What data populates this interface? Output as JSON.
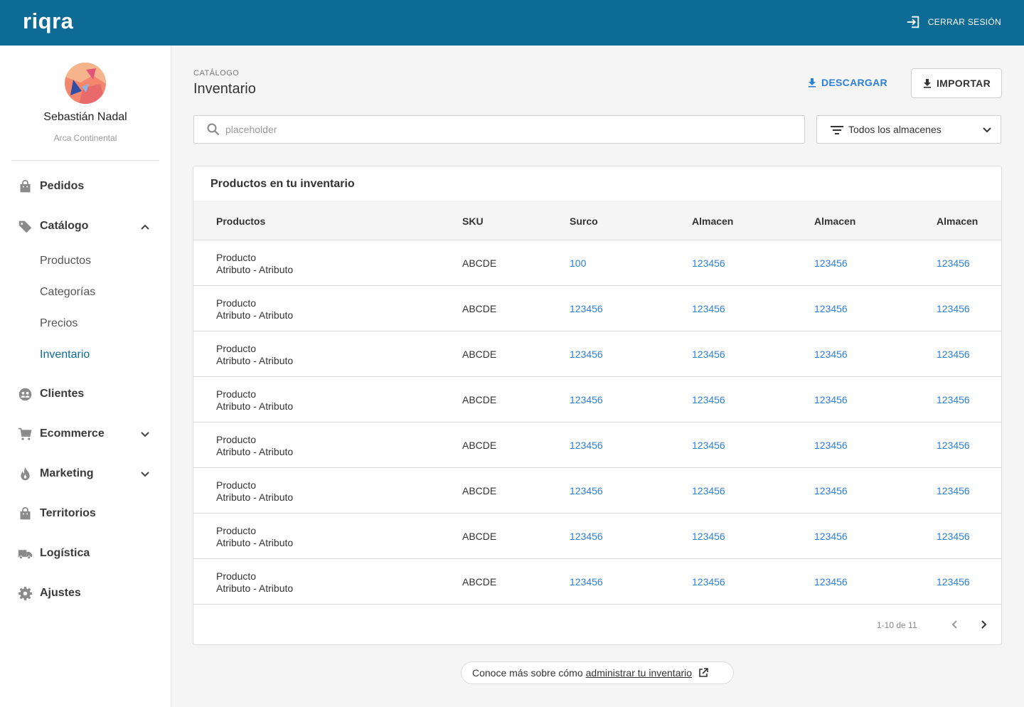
{
  "app": {
    "logo": "riqra",
    "logout_label": "CERRAR SESIÓN"
  },
  "user": {
    "name": "Sebastián Nadal",
    "organization": "Arca Continental"
  },
  "sidebar": {
    "items": [
      {
        "label": "Pedidos",
        "icon": "shopping-bag-icon"
      },
      {
        "label": "Catálogo",
        "icon": "tag-icon",
        "expanded": true,
        "children": [
          {
            "label": "Productos"
          },
          {
            "label": "Categorías"
          },
          {
            "label": "Precios"
          },
          {
            "label": "Inventario",
            "active": true
          }
        ]
      },
      {
        "label": "Clientes",
        "icon": "users-icon"
      },
      {
        "label": "Ecommerce",
        "icon": "cart-icon",
        "expanded": false
      },
      {
        "label": "Marketing",
        "icon": "flame-icon",
        "expanded": false
      },
      {
        "label": "Territorios",
        "icon": "shopping-bag-icon"
      },
      {
        "label": "Logística",
        "icon": "truck-icon"
      },
      {
        "label": "Ajustes",
        "icon": "gear-icon"
      }
    ]
  },
  "header": {
    "breadcrumb": "CATÁLOGO",
    "title": "Inventario",
    "download_label": "DESCARGAR",
    "import_label": "IMPORTAR"
  },
  "search": {
    "placeholder": "placeholder"
  },
  "warehouse_filter": {
    "selected": "Todos los almacenes"
  },
  "table": {
    "title": "Productos en tu inventario",
    "columns": [
      "Productos",
      "SKU",
      "Surco",
      "Almacen",
      "Almacen",
      "Almacen"
    ],
    "rows": [
      {
        "name": "Producto",
        "variant": "Atributo - Atributo",
        "sku": "ABCDE",
        "values": [
          "100",
          "123456",
          "123456",
          "123456"
        ]
      },
      {
        "name": "Producto",
        "variant": "Atributo - Atributo",
        "sku": "ABCDE",
        "values": [
          "123456",
          "123456",
          "123456",
          "123456"
        ]
      },
      {
        "name": "Producto",
        "variant": "Atributo - Atributo",
        "sku": "ABCDE",
        "values": [
          "123456",
          "123456",
          "123456",
          "123456"
        ]
      },
      {
        "name": "Producto",
        "variant": "Atributo - Atributo",
        "sku": "ABCDE",
        "values": [
          "123456",
          "123456",
          "123456",
          "123456"
        ]
      },
      {
        "name": "Producto",
        "variant": "Atributo - Atributo",
        "sku": "ABCDE",
        "values": [
          "123456",
          "123456",
          "123456",
          "123456"
        ]
      },
      {
        "name": "Producto",
        "variant": "Atributo - Atributo",
        "sku": "ABCDE",
        "values": [
          "123456",
          "123456",
          "123456",
          "123456"
        ]
      },
      {
        "name": "Producto",
        "variant": "Atributo - Atributo",
        "sku": "ABCDE",
        "values": [
          "123456",
          "123456",
          "123456",
          "123456"
        ]
      },
      {
        "name": "Producto",
        "variant": "Atributo - Atributo",
        "sku": "ABCDE",
        "values": [
          "123456",
          "123456",
          "123456",
          "123456"
        ]
      }
    ],
    "pagination": "1-10 de 11"
  },
  "help": {
    "prefix": "Conoce más sobre cómo",
    "link": "administrar tu inventario"
  },
  "colors": {
    "brand": "#0e6b96",
    "link": "#2d7fd8",
    "background": "#f5f5f5"
  }
}
